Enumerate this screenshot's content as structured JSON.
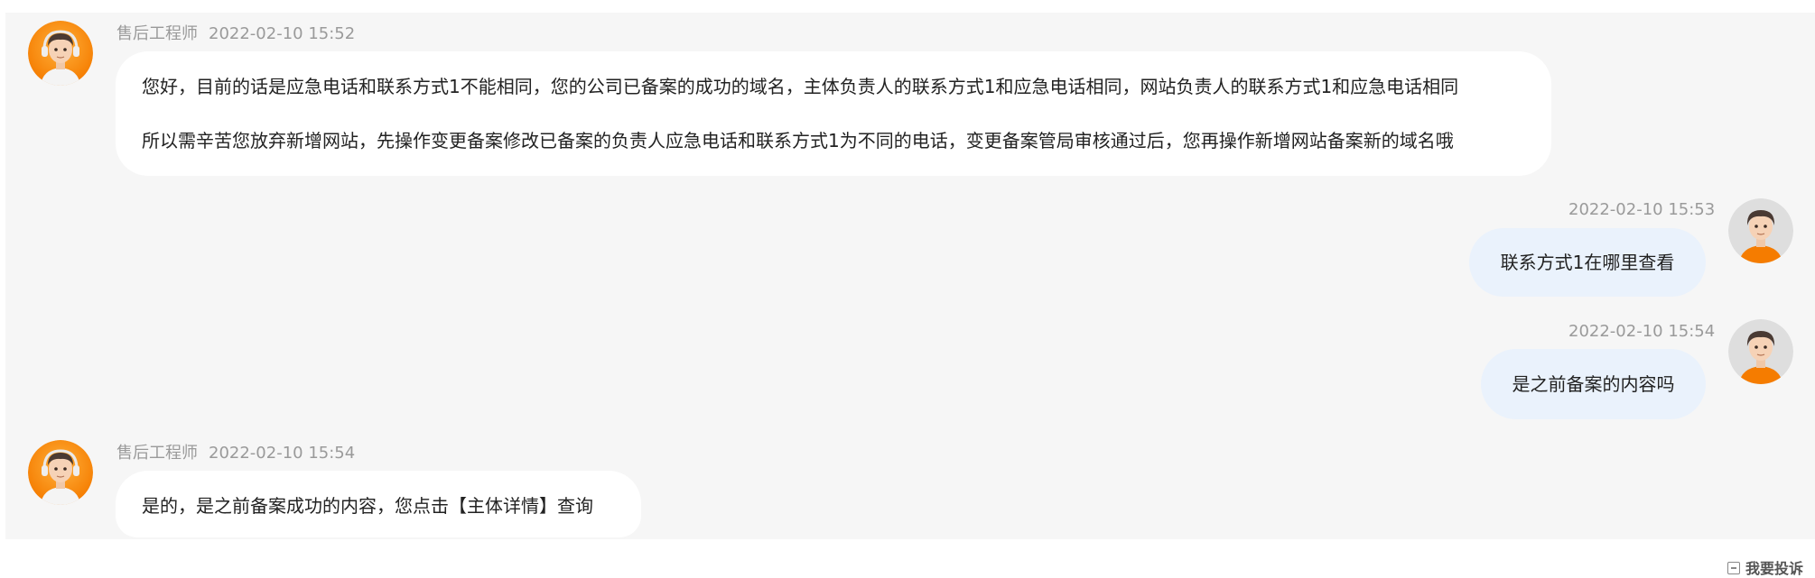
{
  "conversation": {
    "messages": [
      {
        "role": "agent",
        "sender": "售后工程师",
        "time": "2022-02-10 15:52",
        "lines": [
          "您好，目前的话是应急电话和联系方式1不能相同，您的公司已备案的成功的域名，主体负责人的联系方式1和应急电话相同，网站负责人的联系方式1和应急电话相同",
          "所以需辛苦您放弃新增网站，先操作变更备案修改已备案的负责人应急电话和联系方式1为不同的电话，变更备案管局审核通过后，您再操作新增网站备案新的域名哦"
        ],
        "avatar_icon": "agent-avatar-headset"
      },
      {
        "role": "user",
        "time": "2022-02-10 15:53",
        "lines": [
          "联系方式1在哪里查看"
        ],
        "avatar_icon": "user-avatar"
      },
      {
        "role": "user",
        "time": "2022-02-10 15:54",
        "lines": [
          "是之前备案的内容吗"
        ],
        "avatar_icon": "user-avatar"
      },
      {
        "role": "agent",
        "sender": "售后工程师",
        "time": "2022-02-10 15:54",
        "lines": [
          "是的，是之前备案成功的内容，您点击【主体详情】查询"
        ],
        "avatar_icon": "agent-avatar-headset"
      }
    ]
  },
  "footer": {
    "complaint_label": "我要投诉",
    "complaint_icon": "minus-square-icon"
  },
  "colors": {
    "chat_background": "#f6f6f6",
    "agent_bubble": "#ffffff",
    "user_bubble": "#eaf2fc",
    "avatar_orange": "#fb8c00",
    "meta_text": "#9a9a9a",
    "body_text": "#222222"
  }
}
